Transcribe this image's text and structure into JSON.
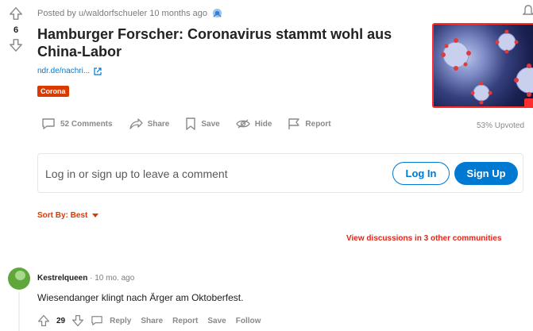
{
  "post": {
    "score": "6",
    "meta": "Posted by u/waldorfschueler 10 months ago",
    "title": "Hamburger Forscher: Coronavirus stammt wohl aus China-Labor",
    "link": "ndr.de/nachri...",
    "flair": "Corona",
    "upvoted": "53% Upvoted"
  },
  "actions": {
    "comments": "52 Comments",
    "share": "Share",
    "save": "Save",
    "hide": "Hide",
    "report": "Report"
  },
  "comment_box": {
    "prompt": "Log in or sign up to leave a comment",
    "login": "Log In",
    "signup": "Sign Up"
  },
  "sort": {
    "label": "Sort By: Best"
  },
  "other_communities": "View discussions in 3 other communities",
  "comment": {
    "author": "Kestrelqueen",
    "time": "· 10 mo. ago",
    "body": "Wiesendanger klingt nach Ärger am Oktoberfest.",
    "score": "29",
    "reply": "Reply",
    "share": "Share",
    "report": "Report",
    "save": "Save",
    "follow": "Follow"
  },
  "colors": {
    "accent": "#0079d3",
    "flair": "#d93a00",
    "alert": "#e0261a"
  },
  "icons": [
    "upvote-icon",
    "downvote-icon",
    "award-icon",
    "bell-icon",
    "external-link-icon",
    "comment-icon",
    "share-icon",
    "save-icon",
    "hide-icon",
    "report-icon",
    "caret-down-icon"
  ]
}
